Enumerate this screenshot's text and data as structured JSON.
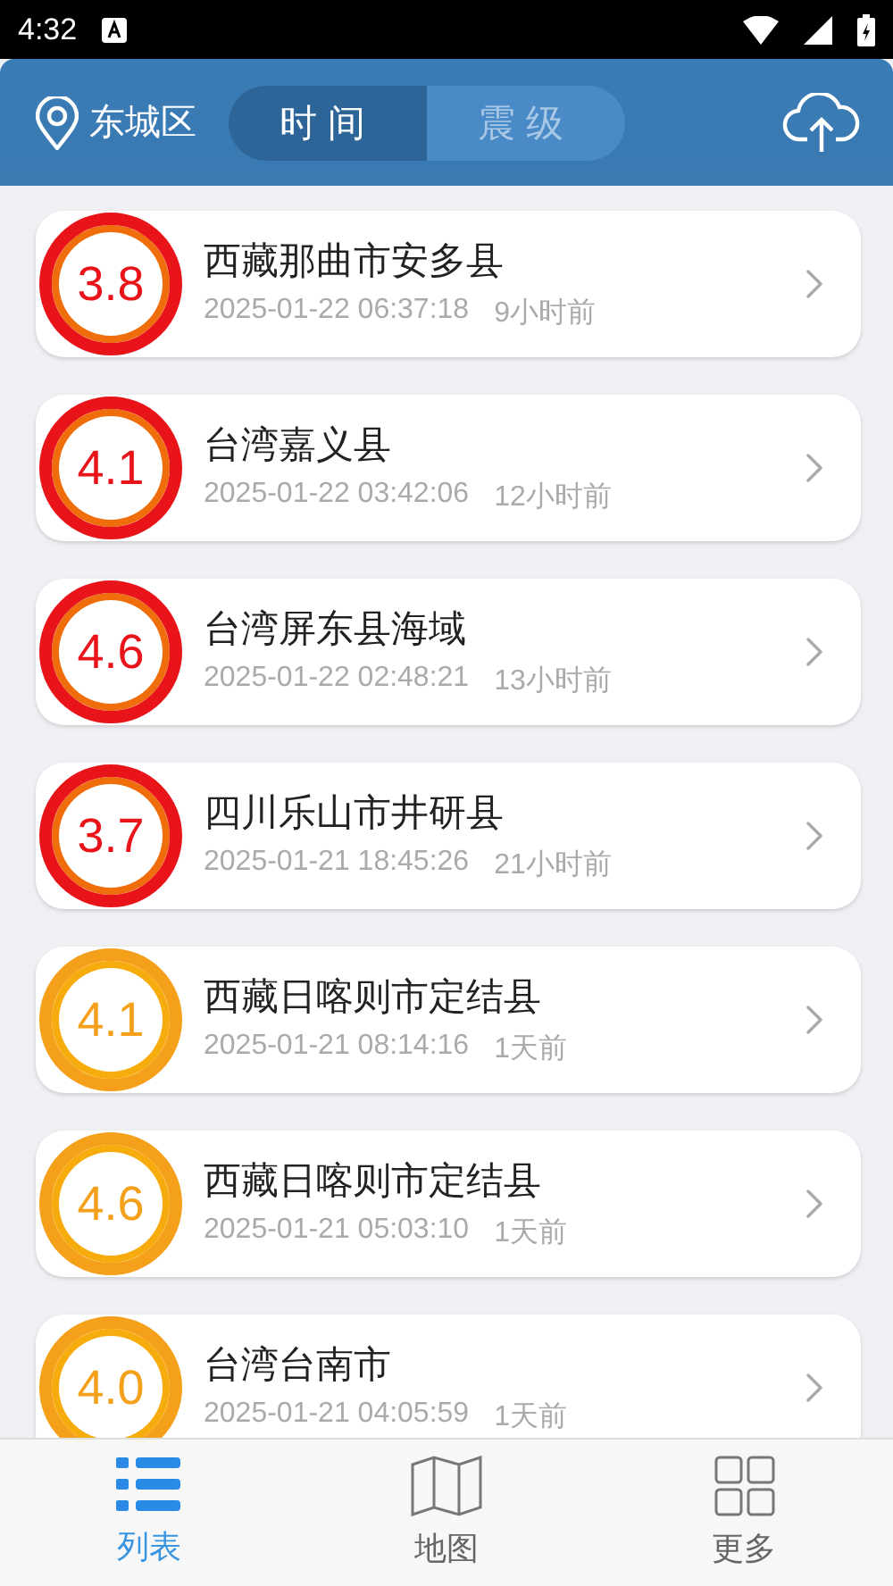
{
  "status_bar": {
    "time": "4:32"
  },
  "header": {
    "location": "东城区",
    "tabs": [
      {
        "label": "时间",
        "selected": true
      },
      {
        "label": "震级",
        "selected": false
      }
    ]
  },
  "quakes": [
    {
      "magnitude": "3.8",
      "place": "西藏那曲市安多县",
      "time": "2025-01-22 06:37:18",
      "ago": "9小时前",
      "color": "#e8141a"
    },
    {
      "magnitude": "4.1",
      "place": "台湾嘉义县",
      "time": "2025-01-22 03:42:06",
      "ago": "12小时前",
      "color": "#e8141a"
    },
    {
      "magnitude": "4.6",
      "place": "台湾屏东县海域",
      "time": "2025-01-22 02:48:21",
      "ago": "13小时前",
      "color": "#e8141a"
    },
    {
      "magnitude": "3.7",
      "place": "四川乐山市井研县",
      "time": "2025-01-21 18:45:26",
      "ago": "21小时前",
      "color": "#e8141a"
    },
    {
      "magnitude": "4.1",
      "place": "西藏日喀则市定结县",
      "time": "2025-01-21 08:14:16",
      "ago": "1天前",
      "color": "#f5a01a"
    },
    {
      "magnitude": "4.6",
      "place": "西藏日喀则市定结县",
      "time": "2025-01-21 05:03:10",
      "ago": "1天前",
      "color": "#f5a01a"
    },
    {
      "magnitude": "4.0",
      "place": "台湾台南市",
      "time": "2025-01-21 04:05:59",
      "ago": "1天前",
      "color": "#f5a01a"
    }
  ],
  "bottom_tabs": [
    {
      "label": "列表",
      "kind": "list",
      "selected": true
    },
    {
      "label": "地图",
      "kind": "map",
      "selected": false
    },
    {
      "label": "更多",
      "kind": "grid",
      "selected": false
    }
  ]
}
